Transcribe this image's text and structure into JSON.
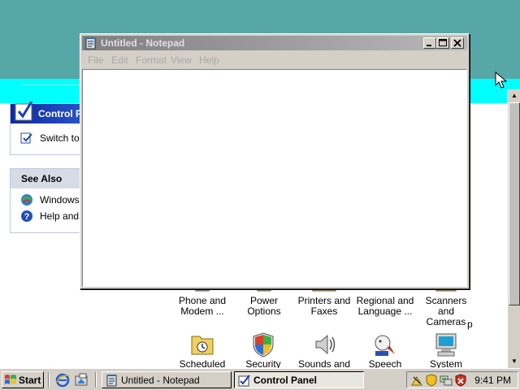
{
  "notepad": {
    "title": "Untitled - Notepad",
    "menu": [
      "File",
      "Edit",
      "Format",
      "View",
      "Help"
    ]
  },
  "control_panel": {
    "header_title": "Control P",
    "switch_label": "Switch to C",
    "see_also": {
      "title": "See Also",
      "items": [
        "Windows U",
        "Help and S"
      ]
    },
    "stray_text": "p",
    "items_row1": [
      {
        "line1": "Phone and",
        "line2": "Modem ...",
        "icon": "phone-modem-icon"
      },
      {
        "line1": "Power Options",
        "line2": "",
        "icon": "power-options-icon"
      },
      {
        "line1": "Printers and",
        "line2": "Faxes",
        "icon": "printers-faxes-icon"
      },
      {
        "line1": "Regional and",
        "line2": "Language ...",
        "icon": "regional-language-icon"
      },
      {
        "line1": "Scanners and",
        "line2": "Cameras",
        "icon": "scanners-cameras-icon"
      }
    ],
    "items_row2": [
      {
        "line1": "Scheduled",
        "icon": "scheduled-tasks-icon"
      },
      {
        "line1": "Security",
        "icon": "security-center-icon"
      },
      {
        "line1": "Sounds and",
        "icon": "sounds-audio-icon"
      },
      {
        "line1": "Speech",
        "icon": "speech-icon"
      },
      {
        "line1": "System",
        "icon": "system-icon"
      }
    ]
  },
  "taskbar": {
    "start_label": "Start",
    "tasks": [
      {
        "label": "Untitled - Notepad",
        "active": false
      },
      {
        "label": "Control Panel",
        "active": true
      }
    ],
    "clock": "9:41 PM"
  },
  "colors": {
    "desktop": "#58a7a7",
    "titlebar_inactive": "#808080",
    "cp_header_blue": "#0b2aa2",
    "face": "#d4d0c8"
  }
}
